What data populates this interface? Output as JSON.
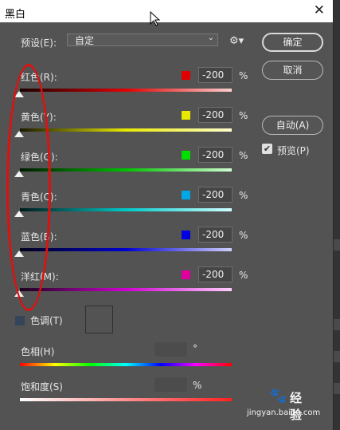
{
  "dialog": {
    "title": "黑白"
  },
  "preset": {
    "label": "预设(E):",
    "value": "自定"
  },
  "buttons": {
    "ok": "确定",
    "cancel": "取消",
    "auto": "自动(A)"
  },
  "preview": {
    "label": "预览(P)",
    "checked": true
  },
  "channels": [
    {
      "label": "红色(R):",
      "value": "-200",
      "unit": "%",
      "color": "#e00000"
    },
    {
      "label": "黄色(Y):",
      "value": "-200",
      "unit": "%",
      "color": "#e8e800"
    },
    {
      "label": "绿色(G):",
      "value": "-200",
      "unit": "%",
      "color": "#00e000"
    },
    {
      "label": "青色(C):",
      "value": "-200",
      "unit": "%",
      "color": "#00a8e8"
    },
    {
      "label": "蓝色(B):",
      "value": "-200",
      "unit": "%",
      "color": "#0000e0"
    },
    {
      "label": "洋红(M):",
      "value": "-200",
      "unit": "%",
      "color": "#e000a0"
    }
  ],
  "tint": {
    "label": "色调(T)",
    "hue": {
      "label": "色相(H)",
      "unit": "°"
    },
    "saturation": {
      "label": "饱和度(S)",
      "unit": "%"
    }
  },
  "watermark": {
    "brand": "经验",
    "url": "jingyan.baidu.com"
  },
  "icons": {
    "close": "close-icon",
    "gear": "gear-icon",
    "dropdown": "chevron-down-icon",
    "cursor": "mouse-cursor-icon"
  }
}
